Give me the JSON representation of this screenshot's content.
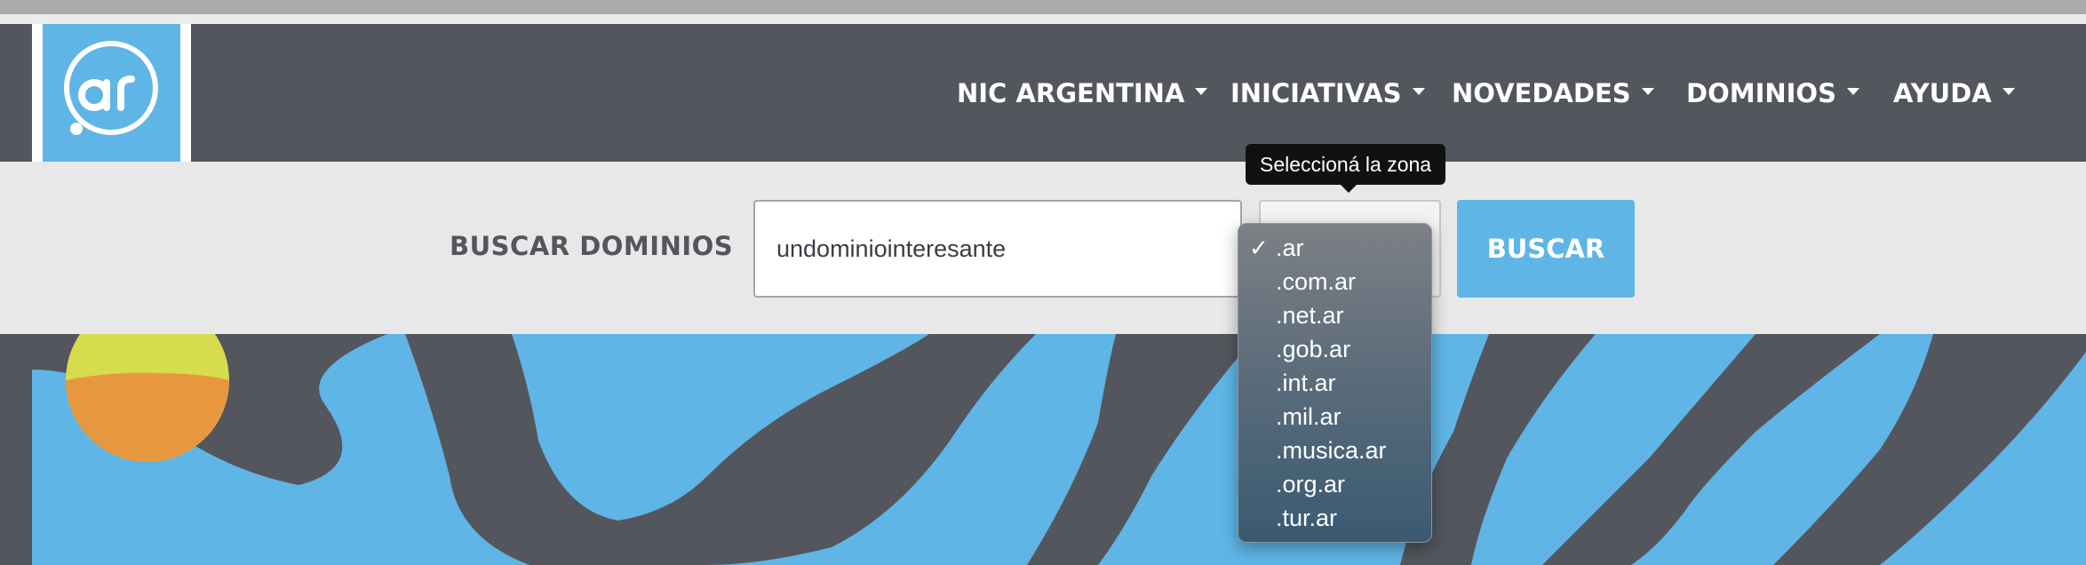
{
  "navbar": {
    "logo_text": ".ar",
    "menu": [
      {
        "label": "NIC ARGENTINA"
      },
      {
        "label": "INICIATIVAS"
      },
      {
        "label": "NOVEDADES"
      },
      {
        "label": "DOMINIOS"
      },
      {
        "label": "AYUDA"
      }
    ]
  },
  "search": {
    "label": "BUSCAR DOMINIOS",
    "input_value": "undominiointeresante",
    "button_label": "BUSCAR",
    "tooltip": "Seleccioná la zona",
    "zone_options": [
      ".ar",
      ".com.ar",
      ".net.ar",
      ".gob.ar",
      ".int.ar",
      ".mil.ar",
      ".musica.ar",
      ".org.ar",
      ".tur.ar"
    ],
    "selected_zone": ".ar",
    "check_mark": "✓"
  },
  "colors": {
    "brand_blue": "#5fb5e5",
    "nav_gray": "#53565d",
    "sun_yellow": "#d6dc4b",
    "sun_orange": "#e7983e"
  }
}
